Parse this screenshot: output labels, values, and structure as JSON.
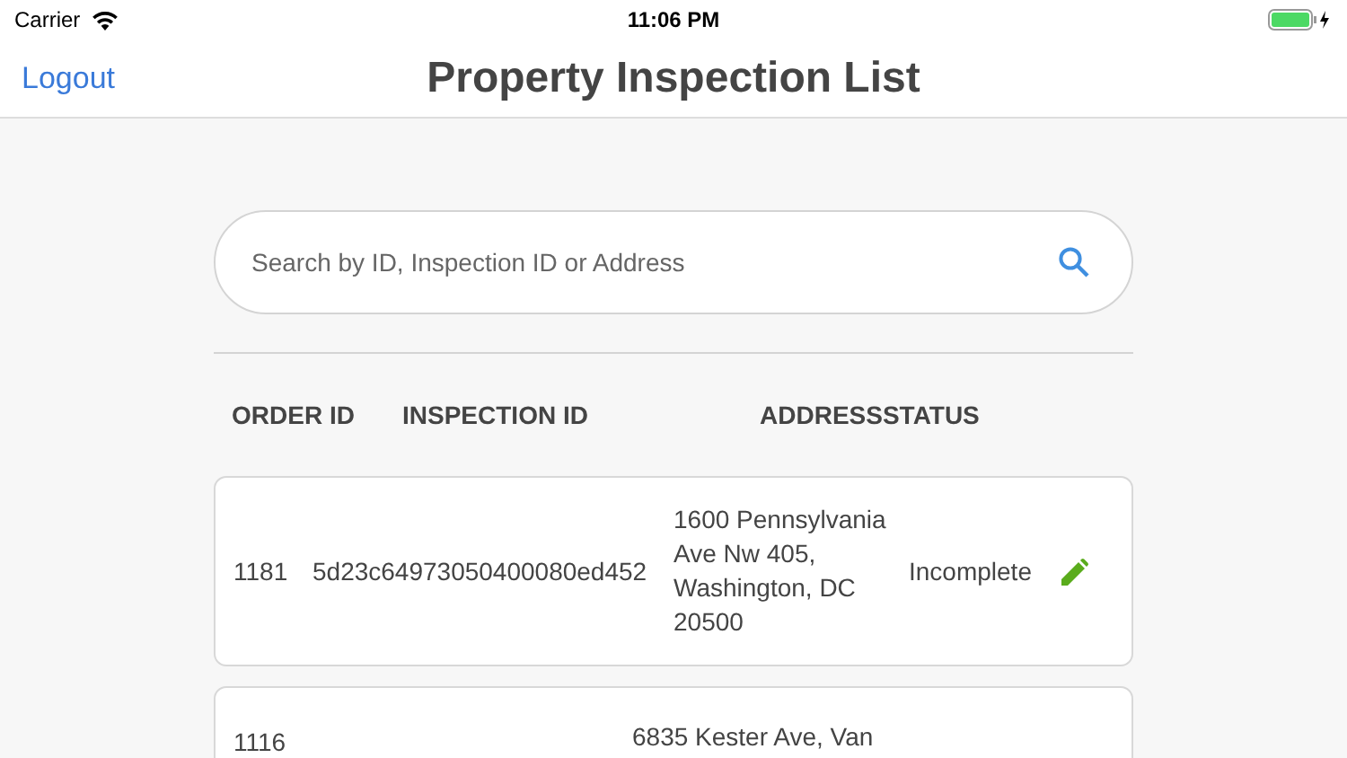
{
  "status_bar": {
    "carrier": "Carrier",
    "time": "11:06 PM"
  },
  "nav_bar": {
    "left_button": "Logout",
    "title": "Property Inspection List"
  },
  "search": {
    "placeholder": "Search by ID, Inspection ID or Address"
  },
  "table": {
    "columns": [
      "ORDER ID",
      "INSPECTION ID",
      "ADDRESS",
      "STATUS"
    ],
    "rows": [
      {
        "order_id": "1181",
        "inspection_id": "5d23c64973050400080ed452",
        "address": "1600 Pennsylvania Ave Nw 405, Washington, DC 20500",
        "status": "Incomplete",
        "kind": "full"
      },
      {
        "order_id": "1116",
        "address": "6835 Kester Ave, Van",
        "kind": "cut"
      }
    ]
  }
}
